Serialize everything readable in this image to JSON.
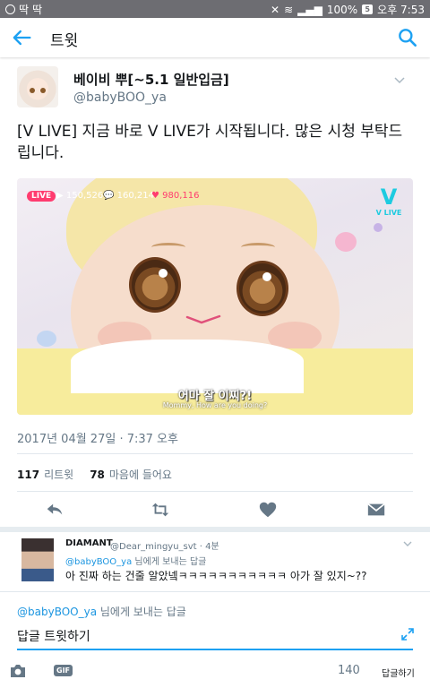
{
  "status_bar": {
    "left_icons": [
      "ⓤ",
      "딱",
      "딱"
    ],
    "battery": "100%",
    "time": "오후 7:53",
    "battery_icon_text": "5"
  },
  "app_bar": {
    "title": "트윗"
  },
  "tweet": {
    "author_name": "베이비 뿌[~5.1 일반입금]",
    "author_handle": "@babyBOO_ya",
    "text": "[V LIVE] 지금 바로 V LIVE가 시작됩니다. 많은 시청 부탁드립니다.",
    "timestamp": "2017년 04월 27일 · 7:37 오후",
    "retweets_count": "117",
    "retweets_label": "리트윗",
    "likes_count": "78",
    "likes_label": "마음에 들어요"
  },
  "video": {
    "live_badge": "LIVE",
    "views": "▶ 150,526",
    "chats": "💬 160,214",
    "hearts": "♥ 980,116",
    "logo_v": "V",
    "logo_text": "V LIVE",
    "subtitle_ko": "어마 잘 이찌?!",
    "subtitle_en": "Mommy, How are you doing?"
  },
  "reply": {
    "name": "DIAMANT",
    "handle_time": "@Dear_mingyu_svt · 4분",
    "reply_to_handle": "@babyBOO_ya",
    "reply_to_suffix": " 님에게 보내는 답글",
    "text": "아 진짜 하는 건줄 알았넼ㅋㅋㅋㅋㅋㅋㅋㅋㅋㅋㅋ 아가 잘 있지~??"
  },
  "compose": {
    "reply_to_handle": "@babyBOO_ya",
    "reply_to_suffix": " 님에게 보내는 답글",
    "placeholder": "답글 트윗하기",
    "gif_label": "GIF",
    "char_count": "140",
    "reply_button": "답글하기"
  },
  "colors": {
    "accent": "#1da1f2",
    "live_pink": "#ff3c6f",
    "vlive_cyan": "#1dcbe0"
  }
}
